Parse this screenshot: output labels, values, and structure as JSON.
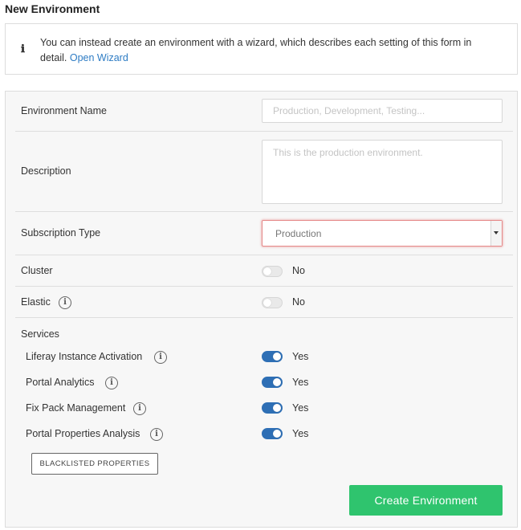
{
  "page": {
    "title": "New Environment"
  },
  "info": {
    "text": "You can instead create an environment with a wizard, which describes each setting of this form in detail.",
    "link": "Open Wizard"
  },
  "form": {
    "environment_name": {
      "label": "Environment Name",
      "placeholder": "Production, Development, Testing..."
    },
    "description": {
      "label": "Description",
      "placeholder": "This is the production environment."
    },
    "subscription_type": {
      "label": "Subscription Type",
      "value": "Production"
    },
    "cluster": {
      "label": "Cluster",
      "state": "No",
      "on": false
    },
    "elastic": {
      "label": "Elastic",
      "state": "No",
      "on": false
    },
    "services": {
      "label": "Services",
      "items": [
        {
          "label": "Liferay Instance Activation",
          "state": "Yes",
          "on": true
        },
        {
          "label": "Portal Analytics",
          "state": "Yes",
          "on": true
        },
        {
          "label": "Fix Pack Management",
          "state": "Yes",
          "on": true
        },
        {
          "label": "Portal Properties Analysis",
          "state": "Yes",
          "on": true
        }
      ]
    },
    "blacklist_button": "BLACKLISTED PROPERTIES",
    "submit_button": "Create Environment"
  },
  "icons": {
    "info": "ℹ",
    "help": "i"
  },
  "colors": {
    "accent": "#2e7cc4",
    "toggle_on": "#2e6fb5",
    "primary_button": "#2fc46e",
    "error_border": "#e58a8a"
  }
}
